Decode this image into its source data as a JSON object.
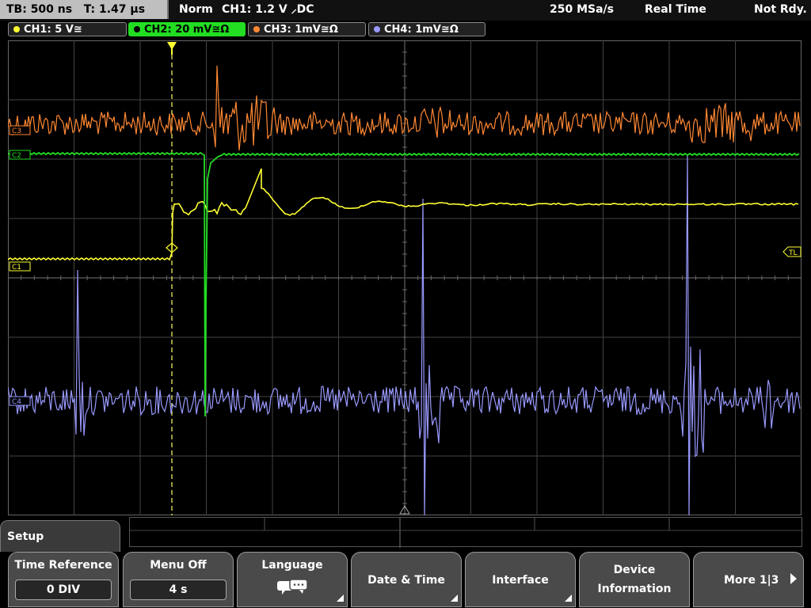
{
  "header": {
    "timebase": "TB: 500 ns",
    "trigger_time": "T: 1.47 µs",
    "mode": "Norm",
    "trigger_info": "CH1: 1.2 V ⸝DC",
    "sample_rate": "250 MSa/s",
    "acq_mode": "Real Time",
    "status": "Not Rdy."
  },
  "channels": [
    {
      "label": "CH1: 5 V≅",
      "color": "#ffff33",
      "active": false
    },
    {
      "label": "CH2: 20 mV≅Ω",
      "color": "#22dd22",
      "active": true
    },
    {
      "label": "CH3: 1mV≅Ω",
      "color": "#ff8833",
      "active": false
    },
    {
      "label": "CH4: 1mV≅Ω",
      "color": "#9999ff",
      "active": false
    }
  ],
  "markers": {
    "ch3": "C3",
    "ch2": "C2",
    "ch1": "C1",
    "ch4": "C4",
    "trigger_level": "TL"
  },
  "menu": {
    "title": "Setup",
    "keys": [
      {
        "label": "Time Reference",
        "value": "0 DIV"
      },
      {
        "label": "Menu Off",
        "value": "4 s"
      },
      {
        "label": "Language",
        "icon": "speech-bubbles-icon"
      },
      {
        "label": "Date & Time"
      },
      {
        "label": "Interface"
      },
      {
        "label": "Device Information",
        "line1": "Device",
        "line2": "Information"
      },
      {
        "label": "More 1|3"
      }
    ]
  },
  "colors": {
    "ch1": "#ffff33",
    "ch2": "#22dd22",
    "ch3": "#ff8833",
    "ch4": "#9999ff",
    "grid": "#5a5a5a"
  }
}
